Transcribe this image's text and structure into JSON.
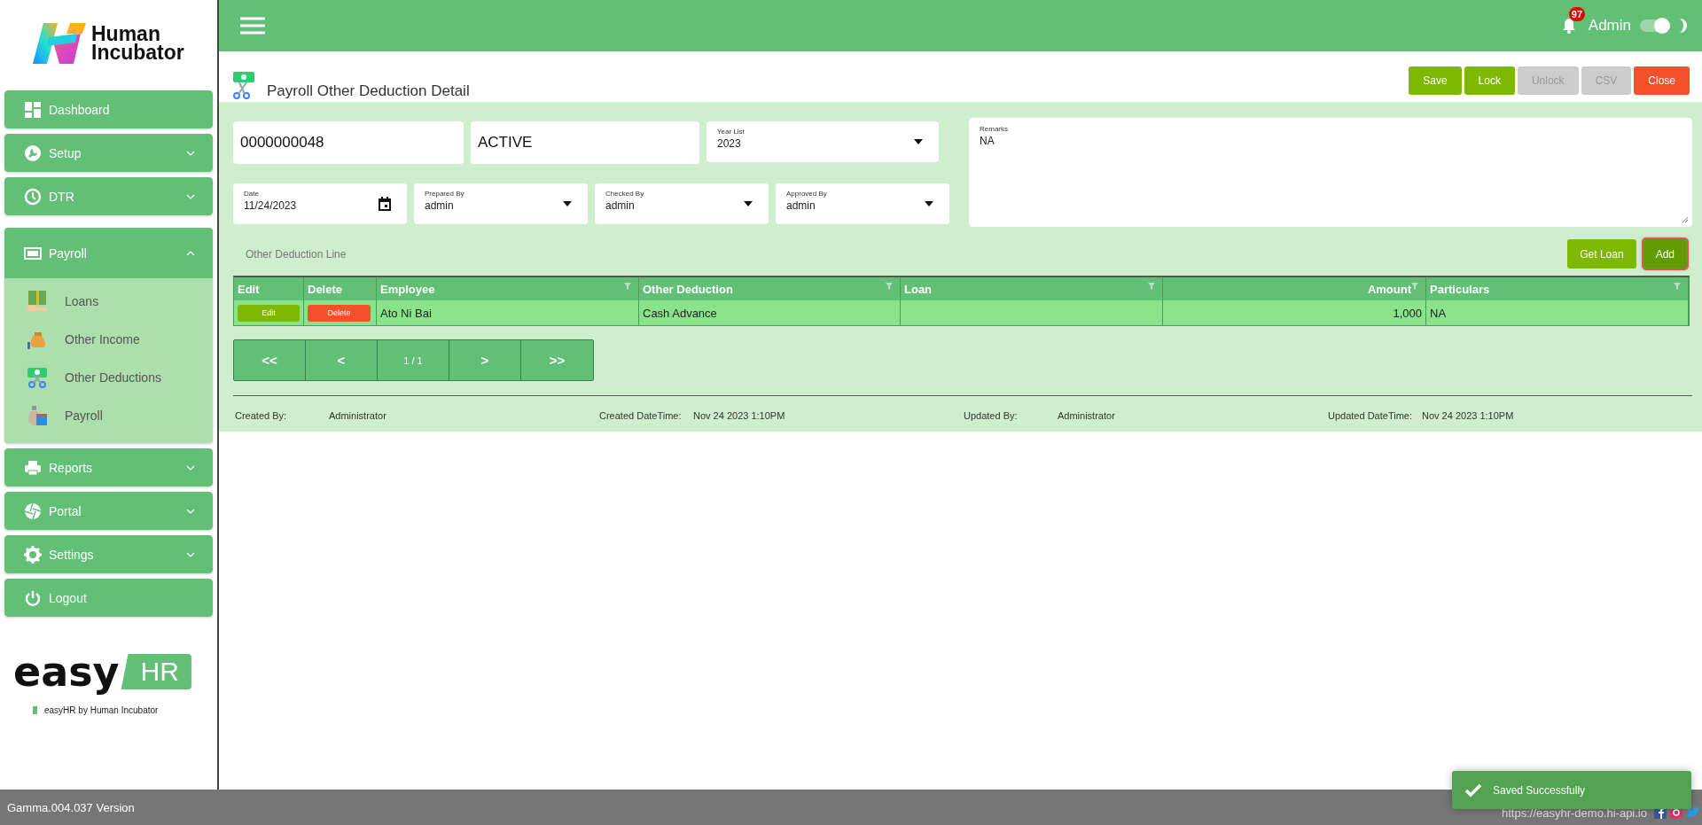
{
  "header": {
    "notification_count": "97",
    "user": "Admin",
    "theme_toggle": {
      "on": true
    }
  },
  "sidebar": {
    "brand": [
      "Human",
      "Incubator"
    ],
    "items": [
      {
        "label": "Dashboard",
        "expandable": false,
        "expanded": false
      },
      {
        "label": "Setup",
        "expandable": true,
        "expanded": false
      },
      {
        "label": "DTR",
        "expandable": true,
        "expanded": false
      },
      {
        "label": "Payroll",
        "expandable": true,
        "expanded": true,
        "children": [
          {
            "label": "Loans"
          },
          {
            "label": "Other Income"
          },
          {
            "label": "Other Deductions"
          },
          {
            "label": "Payroll"
          }
        ]
      },
      {
        "label": "Reports",
        "expandable": true,
        "expanded": false
      },
      {
        "label": "Portal",
        "expandable": true,
        "expanded": false
      },
      {
        "label": "Settings",
        "expandable": true,
        "expanded": false
      },
      {
        "label": "Logout",
        "expandable": false,
        "expanded": false
      }
    ],
    "product_logo": {
      "word": "easy",
      "badge": "HR",
      "tagline": "easyHR by Human Incubator"
    }
  },
  "page": {
    "title": "Payroll Other Deduction Detail",
    "toolbar": [
      {
        "label": "Save",
        "kind": "primary",
        "disabled": false
      },
      {
        "label": "Lock",
        "kind": "primary",
        "disabled": false
      },
      {
        "label": "Unlock",
        "kind": "primary",
        "disabled": true
      },
      {
        "label": "CSV",
        "kind": "primary",
        "disabled": true
      },
      {
        "label": "Close",
        "kind": "danger",
        "disabled": false
      }
    ],
    "form": {
      "number": "0000000048",
      "status": "ACTIVE",
      "year_list": {
        "label": "Year List",
        "value": "2023"
      },
      "date": {
        "label": "Date",
        "value": "11/24/2023"
      },
      "selects": [
        {
          "label": "Prepared By",
          "value": "admin"
        },
        {
          "label": "Checked By",
          "value": "admin"
        },
        {
          "label": "Approved By",
          "value": "admin"
        }
      ],
      "remarks": {
        "label": "Remarks",
        "value": "NA"
      }
    },
    "section_label": "Other Deduction Line",
    "line_buttons": [
      {
        "label": "Get Loan",
        "highlighted": false
      },
      {
        "label": "Add",
        "highlighted": true
      }
    ],
    "table": {
      "columns": [
        {
          "label": "Edit",
          "filter": false
        },
        {
          "label": "Delete",
          "filter": false
        },
        {
          "label": "Employee",
          "filter": true
        },
        {
          "label": "Other Deduction",
          "filter": true
        },
        {
          "label": "Loan",
          "filter": true
        },
        {
          "label": "Amount",
          "filter": true
        },
        {
          "label": "Particulars",
          "filter": true
        }
      ],
      "rows": [
        {
          "cells": [
            "Edit",
            "Delete",
            "Ato Ni Bai",
            "Cash Advance",
            "",
            "1,000",
            "NA"
          ]
        }
      ]
    },
    "pagination": [
      "<<",
      "<",
      "1 / 1",
      ">",
      ">>"
    ],
    "audit": [
      {
        "label": "Created By:",
        "value": "Administrator"
      },
      {
        "label": "Created DateTime:",
        "value": "Nov 24 2023 1:10PM"
      },
      {
        "label": "Updated By:",
        "value": "Administrator"
      },
      {
        "label": "Updated DateTime:",
        "value": "Nov 24 2023 1:10PM"
      }
    ]
  },
  "status_bar": {
    "version": "Gamma.004.037 Version",
    "url": "https://easyhr-demo.hi-api.io"
  },
  "toast": {
    "message": "Saved Successfully"
  }
}
